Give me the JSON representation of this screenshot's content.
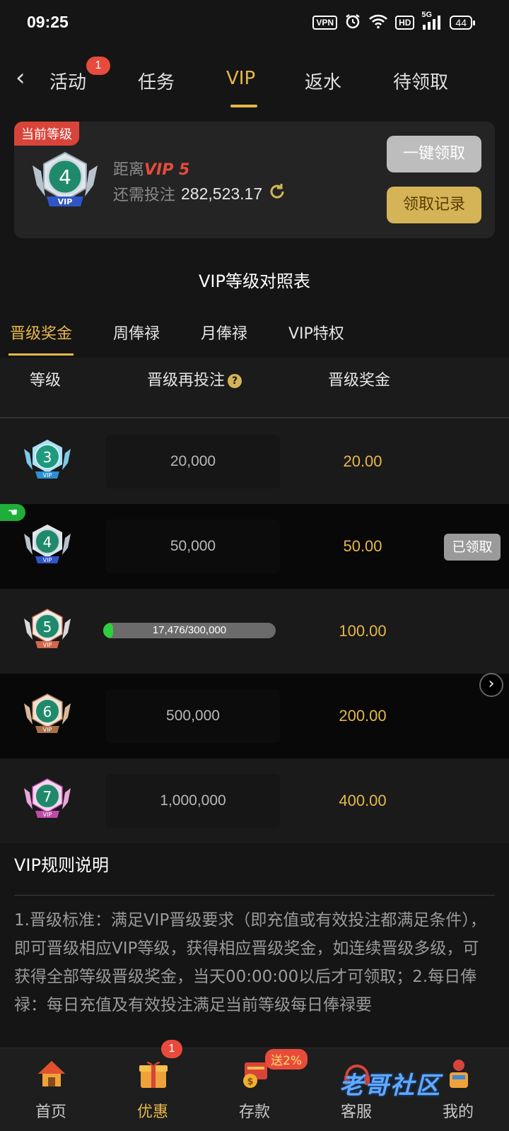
{
  "status_bar": {
    "time": "09:25",
    "vpn": "VPN",
    "hd": "HD",
    "signal": "5G",
    "battery": "44"
  },
  "top_nav": {
    "tabs": [
      "活动",
      "任务",
      "VIP",
      "返水",
      "待领取"
    ],
    "active": "VIP",
    "activity_badge": "1"
  },
  "vip_card": {
    "current_tag": "当前等级",
    "level": "4",
    "distance_label": "距离",
    "next_level": "VIP 5",
    "needed_label": "还需投注",
    "needed_amount": "282,523.17",
    "claim_all": "一键领取",
    "claim_records": "领取记录"
  },
  "table_title": "VIP等级对照表",
  "sub_tabs": [
    "晋级奖金",
    "周俸禄",
    "月俸禄",
    "VIP特权"
  ],
  "table": {
    "headers": [
      "等级",
      "晋级再投注",
      "晋级奖金"
    ],
    "rows": [
      {
        "level": "3",
        "requirement": "20,000",
        "bonus": "20.00"
      },
      {
        "level": "4",
        "requirement": "50,000",
        "bonus": "50.00",
        "status": "已领取"
      },
      {
        "level": "5",
        "progress_text": "17,476/300,000",
        "progress": 0.058,
        "bonus": "100.00"
      },
      {
        "level": "6",
        "requirement": "500,000",
        "bonus": "200.00"
      },
      {
        "level": "7",
        "requirement": "1,000,000",
        "bonus": "400.00"
      }
    ]
  },
  "rules": {
    "title": "VIP规则说明",
    "text": "1.晋级标准：满足VIP晋级要求（即充值或有效投注都满足条件），即可晋级相应VIP等级，获得相应晋级奖金，如连续晋级多级，可获得全部等级晋级奖金，当天00:00:00以后才可领取；2.每日俸禄：每日充值及有效投注满足当前等级每日俸禄要"
  },
  "bottom_nav": {
    "items": [
      "首页",
      "优惠",
      "存款",
      "客服",
      "我的"
    ],
    "active": "优惠",
    "promo_badge": "1",
    "deposit_badge": "送2%"
  },
  "watermark": "老哥社区",
  "colors": {
    "accent_gold": "#e6b84a",
    "red": "#e84b3c",
    "green": "#2fce3e",
    "background": "#151515"
  }
}
